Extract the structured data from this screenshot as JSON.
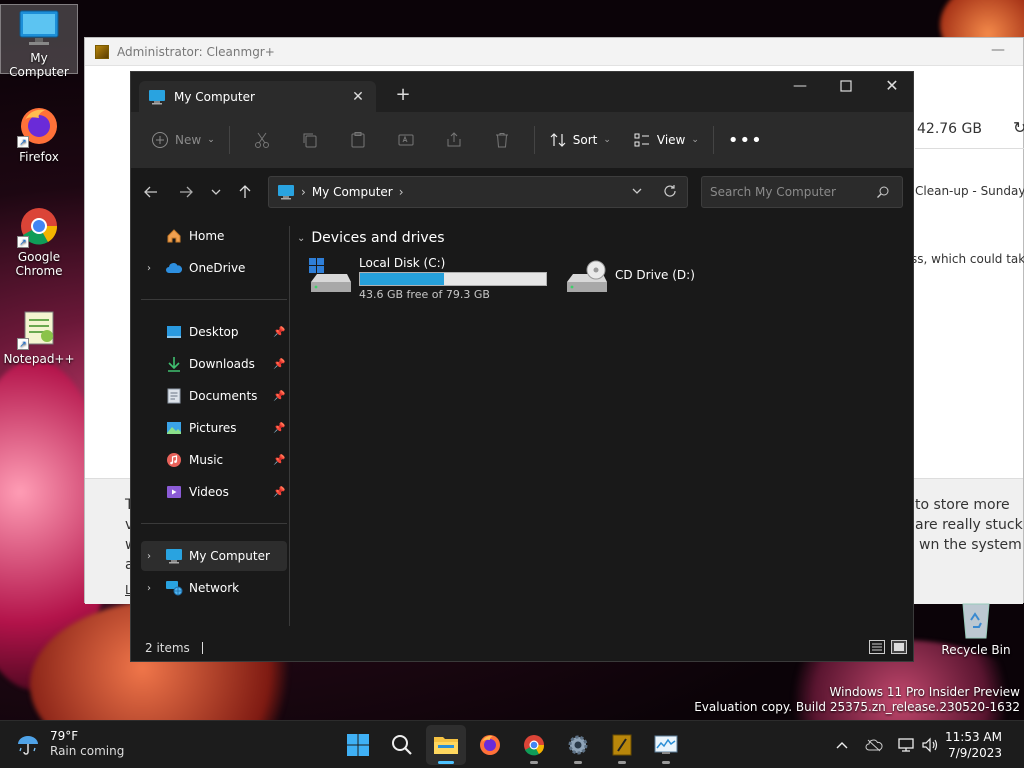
{
  "desktop": {
    "icons": [
      {
        "label": "My Computer"
      },
      {
        "label": "Firefox"
      },
      {
        "label": "Google Chrome"
      },
      {
        "label": "Notepad++"
      }
    ],
    "recycle_bin": "Recycle Bin",
    "watermark": {
      "line1": "Windows 11 Pro Insider Preview",
      "line2": "Evaluation copy. Build 25375.zn_release.230520-1632"
    }
  },
  "background_window": {
    "title": "Administrator: Cleanmgr+",
    "size_text": "42.76 GB",
    "text1": "Clean-up - Sunday,",
    "text2": "ss, which could take",
    "bottom_line1": "to store more",
    "bottom_line2": "are really stuck",
    "bottom_line3": "wn the system",
    "edge_t": "T",
    "edge_v": "v",
    "edge_w": "w",
    "edge_a": "a",
    "edge_l": "L"
  },
  "explorer": {
    "tab_title": "My Computer",
    "toolbar": {
      "new_label": "New",
      "sort_label": "Sort",
      "view_label": "View"
    },
    "address": {
      "crumb": "My Computer"
    },
    "search": {
      "placeholder": "Search My Computer"
    },
    "nav": {
      "home": "Home",
      "onedrive": "OneDrive",
      "desktop": "Desktop",
      "downloads": "Downloads",
      "documents": "Documents",
      "pictures": "Pictures",
      "music": "Music",
      "videos": "Videos",
      "my_computer": "My Computer",
      "network": "Network"
    },
    "group_header": "Devices and drives",
    "drives": [
      {
        "name": "Local Disk (C:)",
        "free_text": "43.6 GB free of 79.3 GB",
        "used_fraction": 0.45
      },
      {
        "name": "CD Drive (D:)"
      }
    ],
    "status": "2 items"
  },
  "taskbar": {
    "weather": {
      "temp": "79°F",
      "desc": "Rain coming"
    },
    "clock": {
      "time": "11:53 AM",
      "date": "7/9/2023"
    }
  }
}
